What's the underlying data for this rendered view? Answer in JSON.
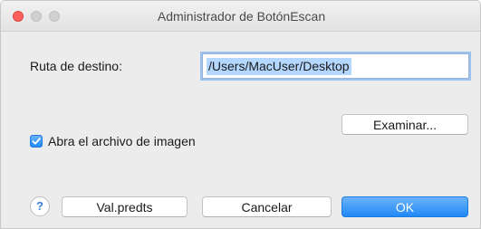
{
  "window": {
    "title": "Administrador de BotónEscan",
    "controls": [
      "close-icon",
      "minimize-icon",
      "zoom-icon"
    ]
  },
  "destination": {
    "label": "Ruta de destino:",
    "value": "/Users/MacUser/Desktop"
  },
  "browse_button": "Examinar...",
  "open_image_checkbox": {
    "label": "Abra el archivo de imagen",
    "checked": true
  },
  "help": {
    "symbol": "?",
    "icon": "help-icon"
  },
  "buttons": {
    "defaults": "Val.predts",
    "cancel": "Cancelar",
    "ok": "OK"
  },
  "colors": {
    "accent": "#1f89f5",
    "close": "#fc605c",
    "selection": "#b3d7ff"
  }
}
